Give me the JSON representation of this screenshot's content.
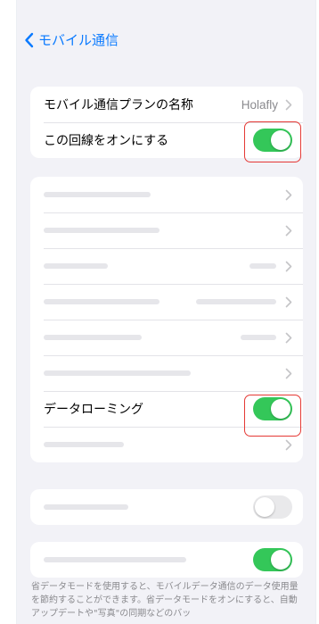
{
  "nav": {
    "back_label": "モバイル通信"
  },
  "plan_group": {
    "plan_name_label": "モバイル通信プランの名称",
    "plan_name_value": "Holafly",
    "line_on_label": "この回線をオンにする",
    "line_on_state": true
  },
  "settings_group": {
    "data_roaming_label": "データローミング",
    "data_roaming_state": true
  },
  "toggle_group_1": {
    "state": false
  },
  "toggle_group_2": {
    "state": true
  },
  "footer": {
    "text": "省データモードを使用すると、モバイルデータ通信のデータ使用量を節約することができます。省データモードをオンにすると、自動アップデートや\"写真\"の同期などのバッ"
  },
  "colors": {
    "accent": "#0a7aff",
    "toggle_on": "#34c759",
    "toggle_off": "#e9e9eb",
    "highlight": "#e53935"
  }
}
